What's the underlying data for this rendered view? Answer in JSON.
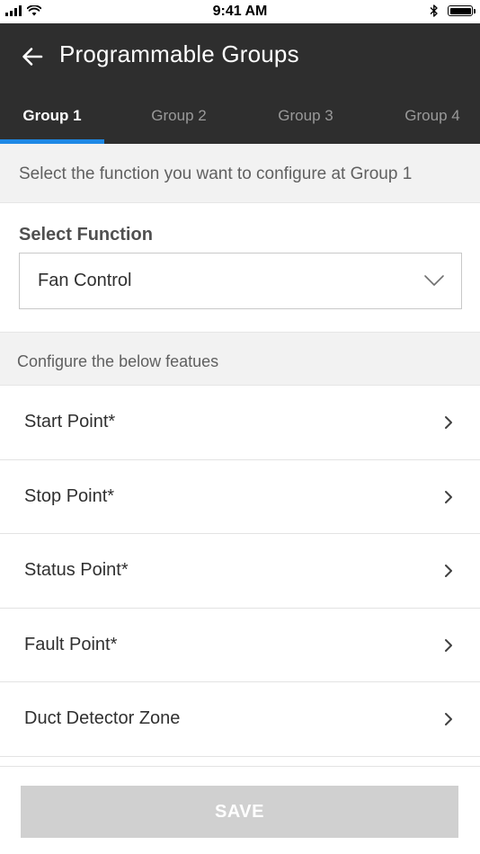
{
  "status_bar": {
    "time": "9:41 AM",
    "icons": [
      "signal-icon",
      "wifi-icon",
      "bluetooth-icon",
      "battery-icon"
    ]
  },
  "header": {
    "title": "Programmable Groups",
    "back_icon": "arrow-left-icon"
  },
  "tabs": [
    {
      "label": "Group 1",
      "active": true
    },
    {
      "label": "Group 2",
      "active": false
    },
    {
      "label": "Group 3",
      "active": false
    },
    {
      "label": "Group 4",
      "active": false
    }
  ],
  "instruction": "Select the function you want to configure at Group 1",
  "select": {
    "label": "Select Function",
    "value": "Fan Control",
    "icon": "chevron-down-icon"
  },
  "features": {
    "header": "Configure the below featues",
    "items": [
      {
        "label": "Start Point*"
      },
      {
        "label": "Stop Point*"
      },
      {
        "label": "Status Point*"
      },
      {
        "label": "Fault Point*"
      },
      {
        "label": "Duct Detector Zone"
      }
    ]
  },
  "footer": {
    "save_label": "SAVE"
  },
  "colors": {
    "appbar": "#2e2e2e",
    "tab_indicator": "#1e88e5",
    "section_bg": "#f2f2f2",
    "save_disabled": "#d0d0d0"
  }
}
